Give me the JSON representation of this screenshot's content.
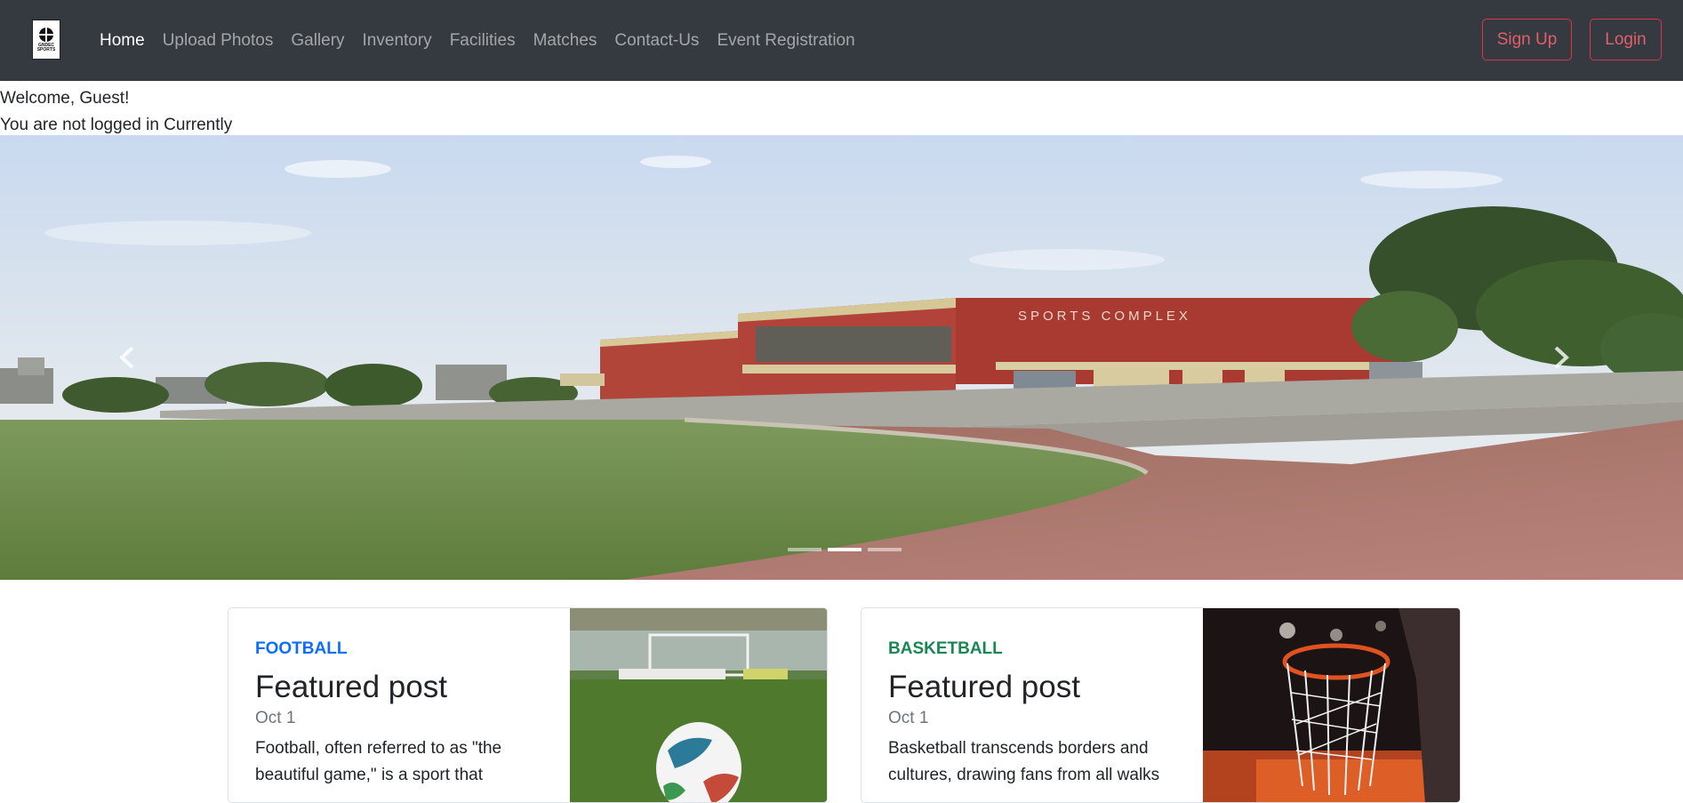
{
  "nav": {
    "logo_text": "GNDEC SPORTS",
    "links": [
      "Home",
      "Upload Photos",
      "Gallery",
      "Inventory",
      "Facilities",
      "Matches",
      "Contact-Us",
      "Event Registration"
    ],
    "signup": "Sign Up",
    "login": "Login",
    "accent": "#dc3545"
  },
  "welcome": {
    "line1": "Welcome, Guest!",
    "line2": "You are not logged in Currently"
  },
  "carousel": {
    "banner_text": "SPORTS COMPLEX",
    "prev_icon": "chevron-left-icon",
    "next_icon": "chevron-right-icon",
    "slides": 3,
    "active_slide": 2
  },
  "cards": [
    {
      "category": "FOOTBALL",
      "title": "Featured post",
      "date": "Oct 1",
      "text": "Football, often referred to as \"the beautiful game,\" is a sport that",
      "color": "#0d6efd"
    },
    {
      "category": "BASKETBALL",
      "title": "Featured post",
      "date": "Oct 1",
      "text": "Basketball transcends borders and cultures, drawing fans from all walks",
      "color": "#198754"
    }
  ]
}
